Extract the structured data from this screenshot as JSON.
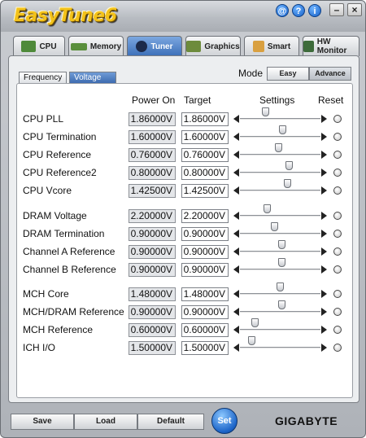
{
  "app": {
    "title": "EasyTune6"
  },
  "titlebar": {
    "at_label": "@",
    "help_label": "?",
    "info_label": "i",
    "minimize_label": "–",
    "close_label": "×"
  },
  "tabs": [
    {
      "label": "CPU"
    },
    {
      "label": "Memory"
    },
    {
      "label": "Tuner"
    },
    {
      "label": "Graphics"
    },
    {
      "label": "Smart"
    },
    {
      "label": "HW Monitor"
    }
  ],
  "subtabs": [
    {
      "label": "Frequency"
    },
    {
      "label": "Voltage"
    }
  ],
  "mode": {
    "label": "Mode",
    "easy": "Easy",
    "advance": "Advance"
  },
  "columns": {
    "power_on": "Power On",
    "target": "Target",
    "settings": "Settings",
    "reset": "Reset"
  },
  "rows": [
    {
      "label": "CPU PLL",
      "power_on": "1.86000V",
      "target": "1.86000V",
      "slider": 0.3
    },
    {
      "label": "CPU Termination",
      "power_on": "1.60000V",
      "target": "1.60000V",
      "slider": 0.53
    },
    {
      "label": "CPU Reference",
      "power_on": "0.76000V",
      "target": "0.76000V",
      "slider": 0.48
    },
    {
      "label": "CPU Reference2",
      "power_on": "0.80000V",
      "target": "0.80000V",
      "slider": 0.62
    },
    {
      "label": "CPU Vcore",
      "power_on": "1.42500V",
      "target": "1.42500V",
      "slider": 0.6
    },
    {
      "label": "DRAM Voltage",
      "power_on": "2.20000V",
      "target": "2.20000V",
      "slider": 0.32
    },
    {
      "label": "DRAM Termination",
      "power_on": "0.90000V",
      "target": "0.90000V",
      "slider": 0.42
    },
    {
      "label": "Channel A Reference",
      "power_on": "0.90000V",
      "target": "0.90000V",
      "slider": 0.52
    },
    {
      "label": "Channel B Reference",
      "power_on": "0.90000V",
      "target": "0.90000V",
      "slider": 0.52
    },
    {
      "label": "MCH Core",
      "power_on": "1.48000V",
      "target": "1.48000V",
      "slider": 0.5
    },
    {
      "label": "MCH/DRAM Reference",
      "power_on": "0.90000V",
      "target": "0.90000V",
      "slider": 0.52
    },
    {
      "label": "MCH Reference",
      "power_on": "0.60000V",
      "target": "0.60000V",
      "slider": 0.16
    },
    {
      "label": "ICH I/O",
      "power_on": "1.50000V",
      "target": "1.50000V",
      "slider": 0.11
    }
  ],
  "bottom": {
    "save": "Save",
    "load": "Load",
    "default": "Default",
    "set": "Set",
    "brand": "GIGABYTE"
  },
  "colors": {
    "accent": "#3c6fb8",
    "logo": "#f3c21a"
  }
}
